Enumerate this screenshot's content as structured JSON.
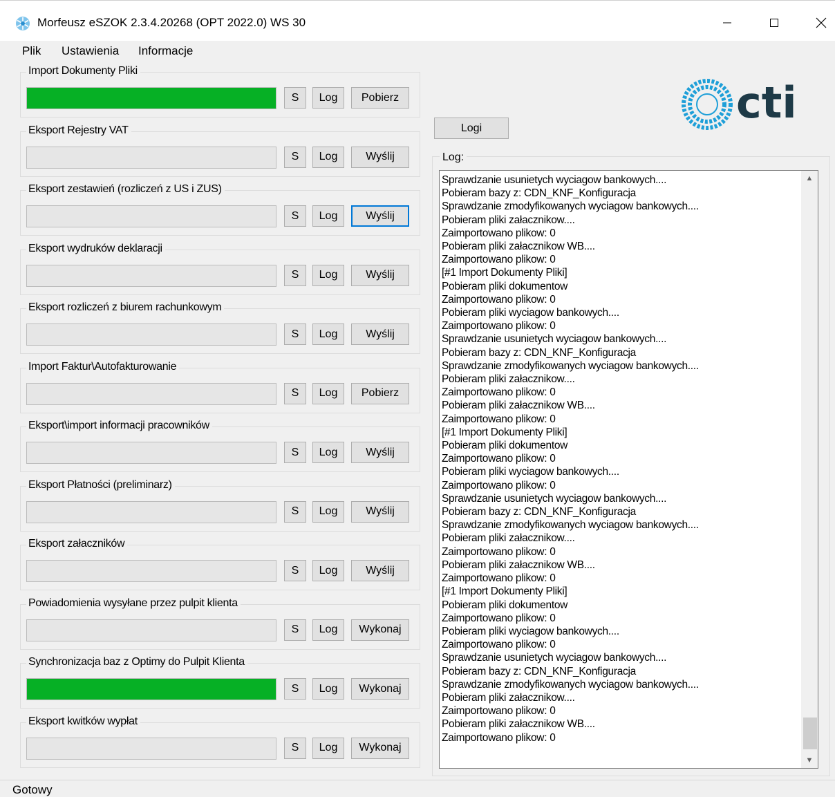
{
  "window": {
    "title": "Morfeusz eSZOK 2.3.4.20268 (OPT 2022.0) WS 30"
  },
  "menu": [
    "Plik",
    "Ustawienia",
    "Informacje"
  ],
  "colors": {
    "progress": "#06b025",
    "accent": "#0078d7",
    "logo": "#1e9fd8"
  },
  "logo_text": "cti",
  "groups": [
    {
      "title": "Import Dokumenty Pliki",
      "s": "S",
      "log": "Log",
      "action": "Pobierz",
      "progress": 1
    },
    {
      "title": "Eksport Rejestry VAT",
      "s": "S",
      "log": "Log",
      "action": "Wyślij",
      "progress": 0
    },
    {
      "title": "Eksport zestawień (rozliczeń z US i ZUS)",
      "s": "S",
      "log": "Log",
      "action": "Wyślij",
      "progress": 0,
      "focused": true
    },
    {
      "title": "Eksport wydruków deklaracji",
      "s": "S",
      "log": "Log",
      "action": "Wyślij",
      "progress": 0
    },
    {
      "title": "Eksport rozliczeń z biurem rachunkowym",
      "s": "S",
      "log": "Log",
      "action": "Wyślij",
      "progress": 0
    },
    {
      "title": "Import Faktur\\Autofakturowanie",
      "s": "S",
      "log": "Log",
      "action": "Pobierz",
      "progress": 0
    },
    {
      "title": "Eksport\\import informacji pracowników",
      "s": "S",
      "log": "Log",
      "action": "Wyślij",
      "progress": 0
    },
    {
      "title": "Eksport Płatności (preliminarz)",
      "s": "S",
      "log": "Log",
      "action": "Wyślij",
      "progress": 0
    },
    {
      "title": "Eksport załaczników",
      "s": "S",
      "log": "Log",
      "action": "Wyślij",
      "progress": 0
    },
    {
      "title": "Powiadomienia wysyłane przez pulpit klienta",
      "s": "S",
      "log": "Log",
      "action": "Wykonaj",
      "progress": 0
    },
    {
      "title": "Synchronizacja baz z Optimy do Pulpit Klienta",
      "s": "S",
      "log": "Log",
      "action": "Wykonaj",
      "progress": 1
    },
    {
      "title": "Eksport kwitków wypłat",
      "s": "S",
      "log": "Log",
      "action": "Wykonaj",
      "progress": 0
    }
  ],
  "logi_button": "Logi",
  "log_title": "Log:",
  "log_lines": [
    "Sprawdzanie usunietych wyciagow bankowych....",
    "Pobieram bazy z: CDN_KNF_Konfiguracja",
    "Sprawdzanie zmodyfikowanych wyciagow bankowych....",
    "Pobieram pliki załacznikow....",
    "Zaimportowano plikow: 0",
    "Pobieram pliki załacznikow WB....",
    "Zaimportowano plikow: 0",
    "[#1 Import Dokumenty Pliki]",
    "Pobieram pliki dokumentow",
    "Zaimportowano plikow: 0",
    "Pobieram pliki wyciagow bankowych....",
    "Zaimportowano plikow: 0",
    "Sprawdzanie usunietych wyciagow bankowych....",
    "Pobieram bazy z: CDN_KNF_Konfiguracja",
    "Sprawdzanie zmodyfikowanych wyciagow bankowych....",
    "Pobieram pliki załacznikow....",
    "Zaimportowano plikow: 0",
    "Pobieram pliki załacznikow WB....",
    "Zaimportowano plikow: 0",
    "[#1 Import Dokumenty Pliki]",
    "Pobieram pliki dokumentow",
    "Zaimportowano plikow: 0",
    "Pobieram pliki wyciagow bankowych....",
    "Zaimportowano plikow: 0",
    "Sprawdzanie usunietych wyciagow bankowych....",
    "Pobieram bazy z: CDN_KNF_Konfiguracja",
    "Sprawdzanie zmodyfikowanych wyciagow bankowych....",
    "Pobieram pliki załacznikow....",
    "Zaimportowano plikow: 0",
    "Pobieram pliki załacznikow WB....",
    "Zaimportowano plikow: 0",
    "[#1 Import Dokumenty Pliki]",
    "Pobieram pliki dokumentow",
    "Zaimportowano plikow: 0",
    "Pobieram pliki wyciagow bankowych....",
    "Zaimportowano plikow: 0",
    "Sprawdzanie usunietych wyciagow bankowych....",
    "Pobieram bazy z: CDN_KNF_Konfiguracja",
    "Sprawdzanie zmodyfikowanych wyciagow bankowych....",
    "Pobieram pliki załacznikow....",
    "Zaimportowano plikow: 0",
    "Pobieram pliki załacznikow WB....",
    "Zaimportowano plikow: 0"
  ],
  "status": "Gotowy"
}
